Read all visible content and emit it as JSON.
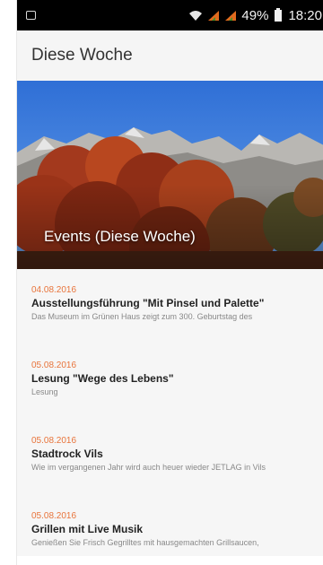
{
  "status_bar": {
    "battery": "49%",
    "time": "18:20"
  },
  "app_bar": {
    "title": "Diese Woche"
  },
  "hero": {
    "title": "Events (Diese Woche)"
  },
  "events": [
    {
      "date": "04.08.2016",
      "title": "Ausstellungsführung \"Mit Pinsel und Palette\"",
      "description": "Das Museum im Grünen Haus zeigt zum 300. Geburtstag des"
    },
    {
      "date": "05.08.2016",
      "title": "Lesung \"Wege des Lebens\"",
      "description": "Lesung"
    },
    {
      "date": "05.08.2016",
      "title": "Stadtrock Vils",
      "description": "Wie im vergangenen Jahr wird auch heuer wieder JETLAG in Vils"
    },
    {
      "date": "05.08.2016",
      "title": "Grillen mit Live Musik",
      "description": "Genießen Sie Frisch Gegrilltes mit hausgemachten Grillsaucen,"
    }
  ],
  "colors": {
    "date_accent": "#e8743b",
    "status_bar_bg": "#000000",
    "app_bar_bg": "#f5f5f5"
  }
}
